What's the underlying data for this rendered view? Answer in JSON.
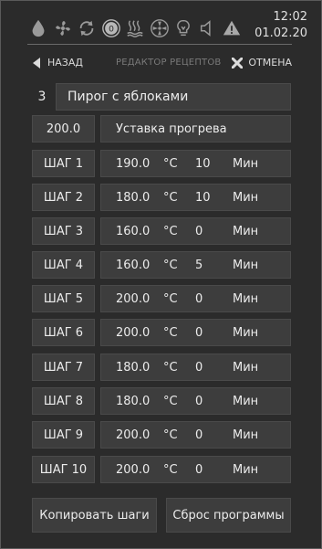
{
  "status": {
    "time": "12:02",
    "date": "01.02.20",
    "icons": [
      "drop-icon",
      "fan-icon",
      "cycle-icon",
      "zero-circle-icon",
      "steam-heat-icon",
      "convection-fan-icon",
      "bulb-icon",
      "speaker-icon",
      "warning-icon"
    ],
    "zero_label": "0"
  },
  "nav": {
    "back_label": "НАЗАД",
    "title": "РЕДАКТОР РЕЦЕПТОВ",
    "cancel_label": "ОТМЕНА"
  },
  "recipe": {
    "number": "3",
    "name": "Пирог с яблоками"
  },
  "preheat": {
    "value": "200.0",
    "label": "Уставка прогрева"
  },
  "steps": [
    {
      "label": "ШАГ 1",
      "temp": "190.0",
      "temp_unit": "°C",
      "duration": "10",
      "duration_unit": "Мин"
    },
    {
      "label": "ШАГ 2",
      "temp": "180.0",
      "temp_unit": "°C",
      "duration": "10",
      "duration_unit": "Мин"
    },
    {
      "label": "ШАГ 3",
      "temp": "160.0",
      "temp_unit": "°C",
      "duration": "0",
      "duration_unit": "Мин"
    },
    {
      "label": "ШАГ 4",
      "temp": "160.0",
      "temp_unit": "°C",
      "duration": "5",
      "duration_unit": "Мин"
    },
    {
      "label": "ШАГ 5",
      "temp": "200.0",
      "temp_unit": "°C",
      "duration": "0",
      "duration_unit": "Мин"
    },
    {
      "label": "ШАГ 6",
      "temp": "200.0",
      "temp_unit": "°C",
      "duration": "0",
      "duration_unit": "Мин"
    },
    {
      "label": "ШАГ 7",
      "temp": "180.0",
      "temp_unit": "°C",
      "duration": "0",
      "duration_unit": "Мин"
    },
    {
      "label": "ШАГ 8",
      "temp": "180.0",
      "temp_unit": "°C",
      "duration": "0",
      "duration_unit": "Мин"
    },
    {
      "label": "ШАГ 9",
      "temp": "200.0",
      "temp_unit": "°C",
      "duration": "0",
      "duration_unit": "Мин"
    },
    {
      "label": "ШАГ 10",
      "temp": "200.0",
      "temp_unit": "°C",
      "duration": "0",
      "duration_unit": "Мин"
    }
  ],
  "actions": {
    "copy_label": "Копировать шаги",
    "reset_label": "Сброс программы"
  },
  "colors": {
    "background": "#2b2b2b",
    "cell": "#3d3d3d",
    "text": "#ececec",
    "muted": "#7a7a7a"
  }
}
